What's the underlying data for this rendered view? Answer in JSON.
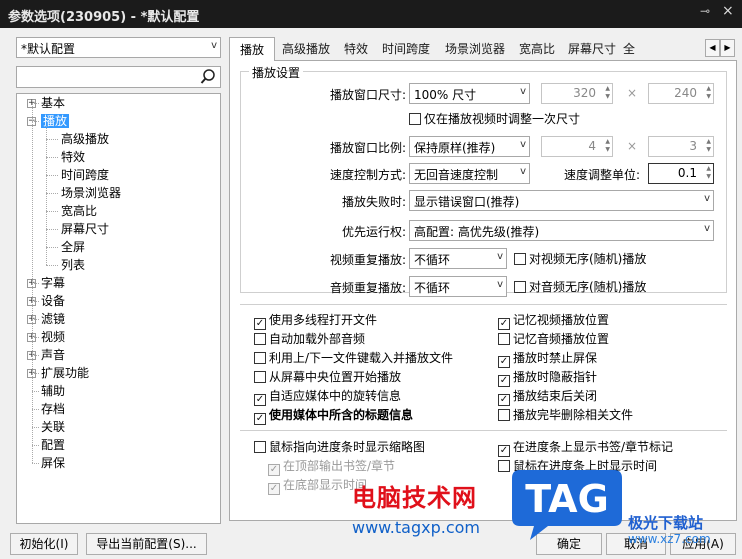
{
  "window": {
    "title": "参数选项(230905) - *默认配置",
    "pin_glyph": "⊸",
    "close_glyph": "×"
  },
  "profile_combo": {
    "value": "*默认配置"
  },
  "search": {
    "placeholder": "",
    "icon": "search-icon"
  },
  "tree": {
    "top_items": [
      {
        "label": "基本",
        "expander": "+"
      },
      {
        "label": "播放",
        "expander": "−",
        "selected": true
      },
      {
        "label": "字幕",
        "expander": "+"
      },
      {
        "label": "设备",
        "expander": "+"
      },
      {
        "label": "滤镜",
        "expander": "+"
      },
      {
        "label": "视频",
        "expander": "+"
      },
      {
        "label": "声音",
        "expander": "+"
      },
      {
        "label": "扩展功能",
        "expander": "+"
      },
      {
        "label": "辅助",
        "expander": ""
      },
      {
        "label": "存档",
        "expander": ""
      },
      {
        "label": "关联",
        "expander": ""
      },
      {
        "label": "配置",
        "expander": ""
      },
      {
        "label": "屏保",
        "expander": ""
      }
    ],
    "play_children": [
      "高级播放",
      "特效",
      "时间跨度",
      "场景浏览器",
      "宽高比",
      "屏幕尺寸",
      "全屏",
      "列表"
    ]
  },
  "tabs": [
    "播放",
    "高级播放",
    "特效",
    "时间跨度",
    "场景浏览器",
    "宽高比",
    "屏幕尺寸",
    "全"
  ],
  "tab_scroll": {
    "left": "◀",
    "right": "▶"
  },
  "play_settings": {
    "group_title": "播放设置",
    "window_size": {
      "label": "播放窗口尺寸:",
      "value": "100% 尺寸",
      "width": "320",
      "height": "240"
    },
    "adjust_once": {
      "label": "仅在播放视频时调整一次尺寸",
      "checked": false
    },
    "window_ratio": {
      "label": "播放窗口比例:",
      "value": "保持原样(推荐)",
      "w": "4",
      "h": "3"
    },
    "speed_mode": {
      "label": "速度控制方式:",
      "value": "无回音速度控制",
      "unit_label": "速度调整单位:",
      "unit_value": "0.1"
    },
    "play_fail": {
      "label": "播放失败时:",
      "value": "显示错误窗口(推荐)"
    },
    "priority": {
      "label": "优先运行权:",
      "value": "高配置: 高优先级(推荐)"
    },
    "video_repeat": {
      "label": "视频重复播放:",
      "value": "不循环",
      "shuffle_label": "对视频无序(随机)播放",
      "shuffle_checked": false
    },
    "audio_repeat": {
      "label": "音频重复播放:",
      "value": "不循环",
      "shuffle_label": "对音频无序(随机)播放",
      "shuffle_checked": false
    }
  },
  "options_left": [
    {
      "label": "使用多线程打开文件",
      "checked": true
    },
    {
      "label": "自动加载外部音频",
      "checked": false
    },
    {
      "label": "利用上/下一文件键载入并播放文件",
      "checked": false
    },
    {
      "label": "从屏幕中央位置开始播放",
      "checked": false
    },
    {
      "label": "自适应媒体中的旋转信息",
      "checked": true
    },
    {
      "label": "使用媒体中所含的标题信息",
      "checked": true,
      "bold": true
    }
  ],
  "options_right": [
    {
      "label": "记忆视频播放位置",
      "checked": true
    },
    {
      "label": "记忆音频播放位置",
      "checked": false
    },
    {
      "label": "播放时禁止屏保",
      "checked": true
    },
    {
      "label": "播放时隐蔽指针",
      "checked": true
    },
    {
      "label": "播放结束后关闭",
      "checked": true
    },
    {
      "label": "播放完毕删除相关文件",
      "checked": false
    }
  ],
  "seekbar_left": [
    {
      "label": "鼠标指向进度条时显示缩略图",
      "checked": false,
      "disabled": false
    },
    {
      "label": "在顶部输出书签/章节",
      "checked": true,
      "disabled": true
    },
    {
      "label": "在底部显示时间",
      "checked": true,
      "disabled": true
    }
  ],
  "seekbar_right": [
    {
      "label": "在进度条上显示书签/章节标记",
      "checked": true
    },
    {
      "label": "鼠标在进度条上时显示时间",
      "checked": false
    }
  ],
  "buttons": {
    "init": "初始化(I)",
    "export": "导出当前配置(S)...",
    "ok": "确定",
    "cancel": "取消",
    "apply": "应用(A)"
  },
  "watermark": {
    "cn": "电脑技术网",
    "url": "www.tagxp.com",
    "tag": "TAG",
    "brand": "极光下载站",
    "brand_url": "www.xz7.com"
  },
  "colors": {
    "selection": "#3399ff",
    "title_bar": "#1b1b1b",
    "watermark_red": "#e0101a",
    "tag_blue": "#1e6ad8"
  }
}
